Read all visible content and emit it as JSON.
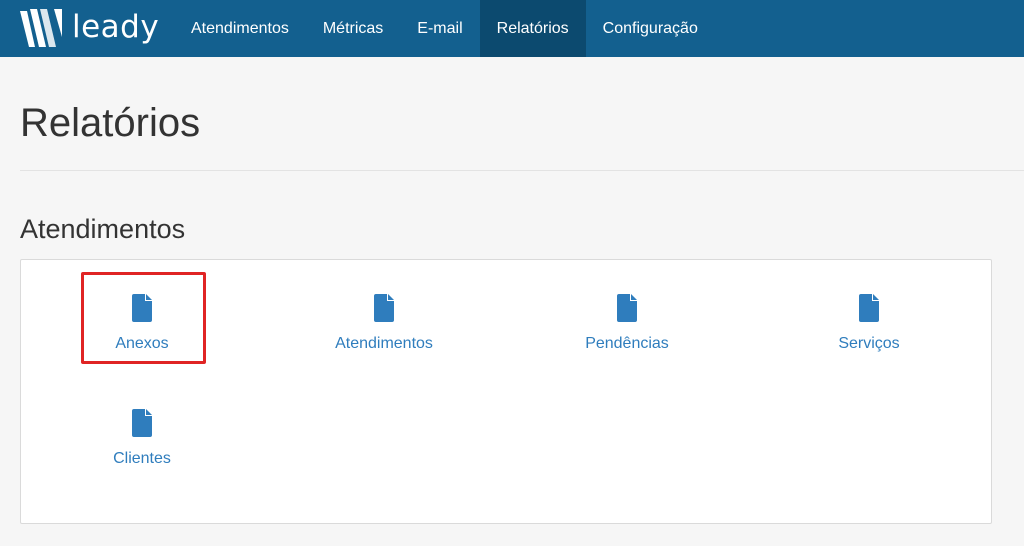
{
  "brand": {
    "name": "leady"
  },
  "nav": {
    "items": [
      {
        "label": "Atendimentos",
        "active": false
      },
      {
        "label": "Métricas",
        "active": false
      },
      {
        "label": "E-mail",
        "active": false
      },
      {
        "label": "Relatórios",
        "active": true
      },
      {
        "label": "Configuração",
        "active": false
      }
    ]
  },
  "page": {
    "title": "Relatórios"
  },
  "section": {
    "title": "Atendimentos",
    "reports": [
      {
        "label": "Anexos",
        "icon": "file-icon",
        "highlighted": true
      },
      {
        "label": "Atendimentos",
        "icon": "file-icon"
      },
      {
        "label": "Pendências",
        "icon": "file-icon"
      },
      {
        "label": "Serviços",
        "icon": "file-icon"
      },
      {
        "label": "Clientes",
        "icon": "file-icon"
      }
    ]
  },
  "colors": {
    "navbar": "#13608f",
    "nav_active": "#0c4a6f",
    "link": "#2f7dbd",
    "highlight": "#e02424"
  }
}
